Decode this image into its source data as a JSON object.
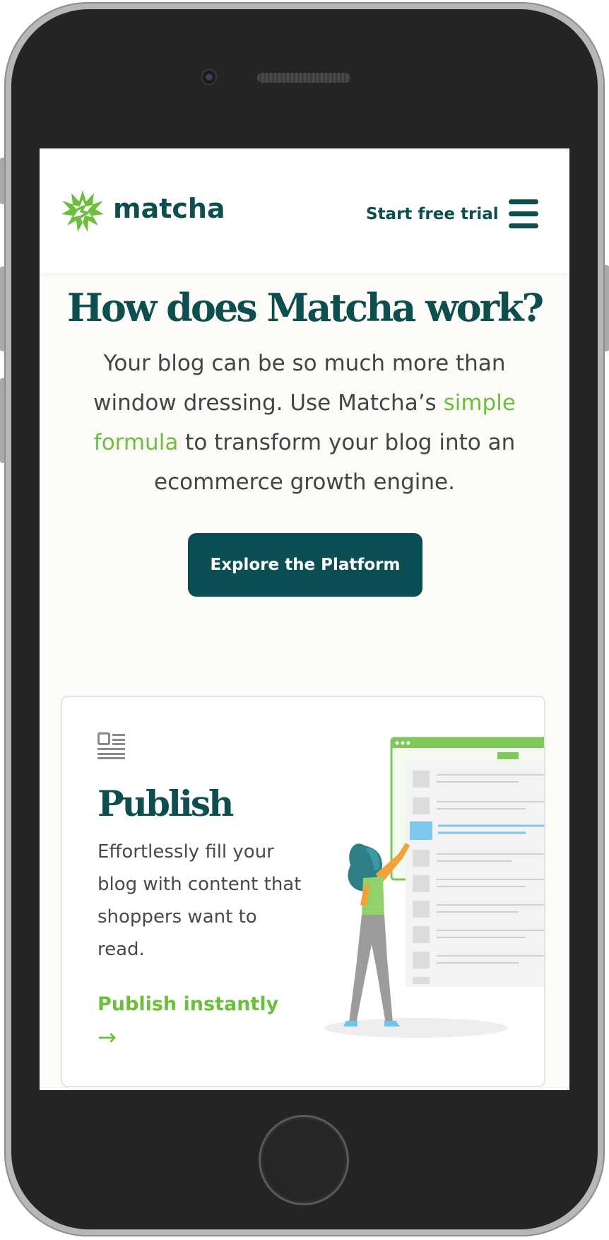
{
  "device": {
    "type": "phone",
    "icons": [
      "camera-icon",
      "speaker-grille-icon",
      "home-button-icon"
    ]
  },
  "header": {
    "logo_text": "matcha",
    "logo_icon": "matcha-star-icon",
    "cta_label": "Start free trial",
    "menu_icon": "hamburger-menu-icon"
  },
  "hero": {
    "title": "How does Matcha work?",
    "copy_before": "Your blog can be so much more than window dressing. Use Matcha’s ",
    "copy_link": "simple formula",
    "copy_after": " to transform your blog into an ecommerce growth engine.",
    "button_label": "Explore the Platform"
  },
  "card": {
    "icon": "article-layout-icon",
    "title": "Publish",
    "copy": "Effortlessly fill your blog with content that shoppers want to read.",
    "link_label": "Publish instantly",
    "link_arrow": "→",
    "illustration": "woman-arranging-blog-posts-illustration"
  },
  "colors": {
    "brand_dark": "#0d4f4f",
    "button_dark": "#0b4f55",
    "brand_green": "#6cbf3c",
    "body_text": "#404547",
    "page_bg": "#fdfbf7"
  }
}
